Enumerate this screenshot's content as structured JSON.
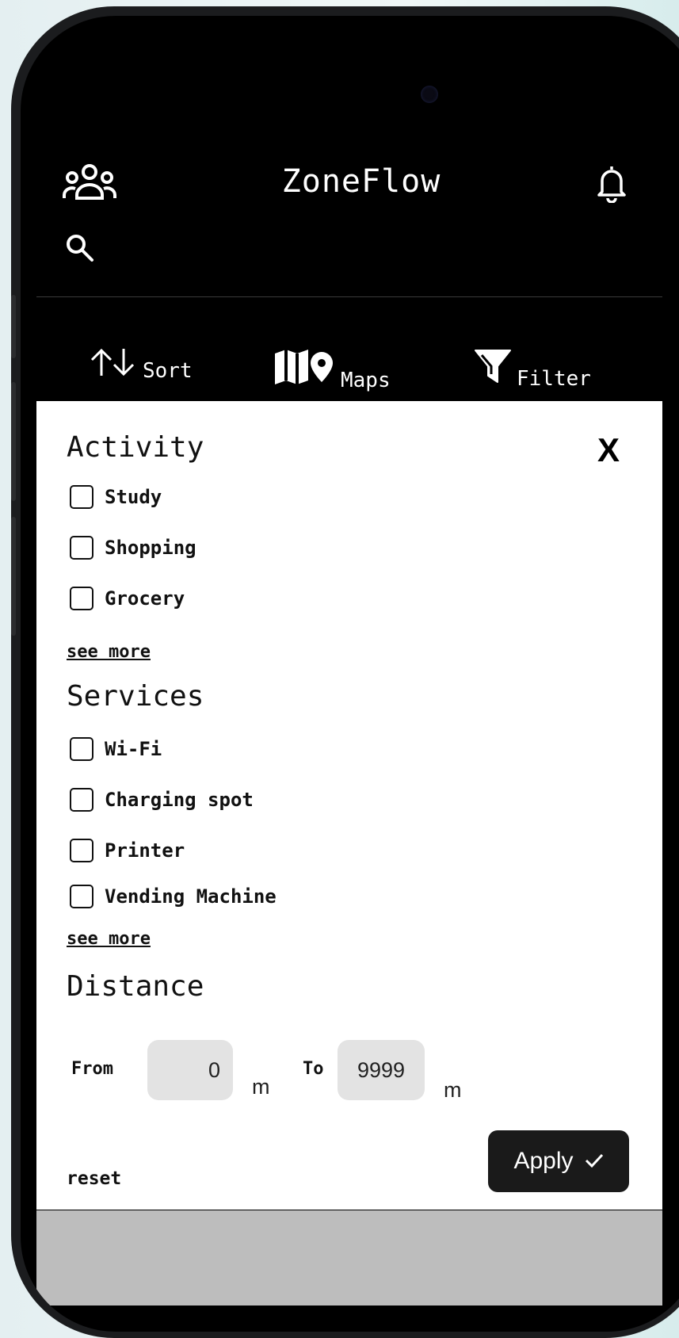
{
  "header": {
    "title": "ZoneFlow",
    "left_icon": "people-group-icon",
    "right_icon": "bell-icon",
    "search_icon": "search-icon"
  },
  "toolbar": {
    "sort_label": "Sort",
    "maps_label": "Maps",
    "filter_label": "Filter"
  },
  "filter_panel": {
    "close_label": "X",
    "activity": {
      "title": "Activity",
      "options": [
        "Study",
        "Shopping",
        "Grocery"
      ],
      "see_more": "see more"
    },
    "services": {
      "title": "Services",
      "options": [
        "Wi-Fi",
        "Charging spot",
        "Printer",
        "Vending Machine"
      ],
      "see_more": "see more"
    },
    "distance": {
      "title": "Distance",
      "from_label": "From",
      "from_value": "0",
      "from_unit": "m",
      "to_label": "To",
      "to_value": "9999",
      "to_unit": "m"
    },
    "reset_label": "reset",
    "apply_label": "Apply"
  }
}
